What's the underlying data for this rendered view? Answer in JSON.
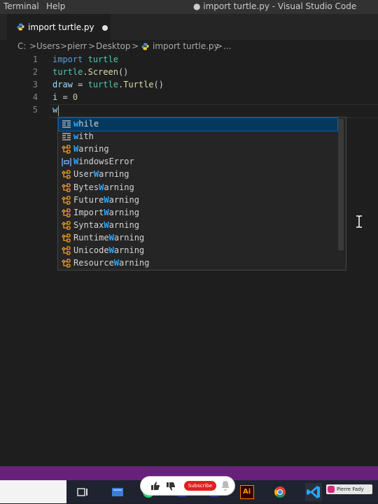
{
  "menu": {
    "terminal": "Terminal",
    "help": "Help"
  },
  "window_title": "● import turtle.py - Visual Studio Code",
  "tab": {
    "label": "import turtle.py"
  },
  "breadcrumb": {
    "drive": "C:",
    "sep": ">",
    "p1": "Users",
    "p2": "pierr",
    "p3": "Desktop",
    "file": "import turtle.py",
    "more": "..."
  },
  "editor": {
    "line_numbers": [
      "1",
      "2",
      "3",
      "4",
      "5"
    ],
    "lines": [
      [
        {
          "t": "import",
          "c": "kw"
        },
        {
          "t": " "
        },
        {
          "t": "turtle",
          "c": "cls"
        }
      ],
      [
        {
          "t": "turtle",
          "c": "cls"
        },
        {
          "t": "."
        },
        {
          "t": "Screen",
          "c": "fn"
        },
        {
          "t": "()"
        }
      ],
      [
        {
          "t": "draw",
          "c": "id"
        },
        {
          "t": " = "
        },
        {
          "t": "turtle",
          "c": "cls"
        },
        {
          "t": "."
        },
        {
          "t": "Turtle",
          "c": "fn"
        },
        {
          "t": "()"
        }
      ],
      [
        {
          "t": "i",
          "c": "id"
        },
        {
          "t": " = "
        },
        {
          "t": "0",
          "c": "num"
        }
      ],
      [
        {
          "t": "w",
          "c": "id"
        }
      ]
    ]
  },
  "suggestions": [
    {
      "kind": "snippet",
      "pre": "",
      "hl": "w",
      "post": "hile",
      "selected": true
    },
    {
      "kind": "snippet",
      "pre": "",
      "hl": "w",
      "post": "ith",
      "selected": false
    },
    {
      "kind": "class",
      "pre": "",
      "hl": "W",
      "post": "arning",
      "selected": false
    },
    {
      "kind": "variable",
      "pre": "",
      "hl": "W",
      "post": "indowsError",
      "selected": false
    },
    {
      "kind": "class",
      "pre": "User",
      "hl": "W",
      "post": "arning",
      "selected": false
    },
    {
      "kind": "class",
      "pre": "Bytes",
      "hl": "W",
      "post": "arning",
      "selected": false
    },
    {
      "kind": "class",
      "pre": "Future",
      "hl": "W",
      "post": "arning",
      "selected": false
    },
    {
      "kind": "class",
      "pre": "Import",
      "hl": "W",
      "post": "arning",
      "selected": false
    },
    {
      "kind": "class",
      "pre": "Syntax",
      "hl": "W",
      "post": "arning",
      "selected": false
    },
    {
      "kind": "class",
      "pre": "Runtime",
      "hl": "W",
      "post": "arning",
      "selected": false
    },
    {
      "kind": "class",
      "pre": "Unicode",
      "hl": "W",
      "post": "arning",
      "selected": false
    },
    {
      "kind": "class",
      "pre": "Resource",
      "hl": "W",
      "post": "arning",
      "selected": false
    }
  ],
  "overlay": {
    "subscribe_label": "Subscribe",
    "creator": "Pierre Fady"
  },
  "taskbar": {
    "illustrator_label": "Ai"
  },
  "colors": {
    "accent": "#007acc",
    "status_bar": "#68217a",
    "selection": "#04395e",
    "match_highlight": "#2aaaff"
  }
}
